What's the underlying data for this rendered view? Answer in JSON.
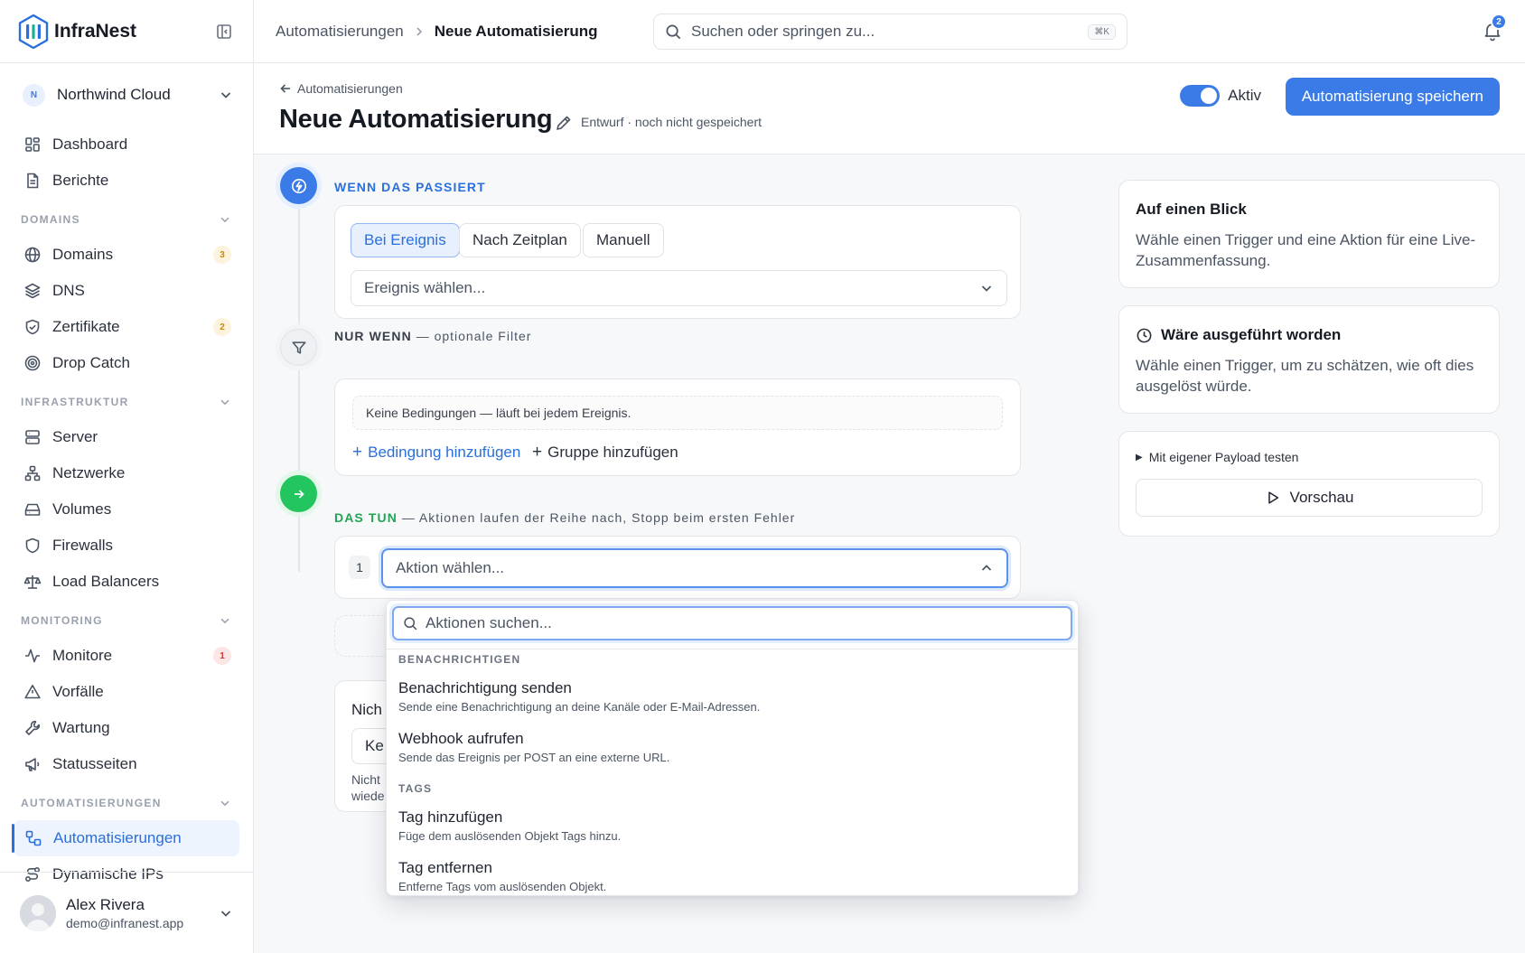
{
  "app": {
    "name": "InfraNest"
  },
  "org": {
    "initial": "N",
    "name": "Northwind Cloud"
  },
  "nav": {
    "top": [
      {
        "label": "Dashboard",
        "icon": "dashboard-icon"
      },
      {
        "label": "Berichte",
        "icon": "report-icon"
      }
    ],
    "sections": [
      {
        "title": "DOMAINS",
        "items": [
          {
            "label": "Domains",
            "icon": "globe-icon",
            "badge": "3",
            "badge_color": "amber"
          },
          {
            "label": "DNS",
            "icon": "layers-icon"
          },
          {
            "label": "Zertifikate",
            "icon": "shield-check-icon",
            "badge": "2",
            "badge_color": "amber"
          },
          {
            "label": "Drop Catch",
            "icon": "target-icon"
          }
        ]
      },
      {
        "title": "INFRASTRUKTUR",
        "items": [
          {
            "label": "Server",
            "icon": "server-icon"
          },
          {
            "label": "Netzwerke",
            "icon": "network-icon"
          },
          {
            "label": "Volumes",
            "icon": "drive-icon"
          },
          {
            "label": "Firewalls",
            "icon": "shield-icon"
          },
          {
            "label": "Load Balancers",
            "icon": "scale-icon"
          }
        ]
      },
      {
        "title": "MONITORING",
        "items": [
          {
            "label": "Monitore",
            "icon": "activity-icon",
            "badge": "1",
            "badge_color": "red"
          },
          {
            "label": "Vorfälle",
            "icon": "warning-icon"
          },
          {
            "label": "Wartung",
            "icon": "wrench-icon"
          },
          {
            "label": "Statusseiten",
            "icon": "megaphone-icon"
          }
        ]
      },
      {
        "title": "AUTOMATISIERUNGEN",
        "items": [
          {
            "label": "Automatisierungen",
            "icon": "workflow-icon",
            "active": true
          },
          {
            "label": "Dynamische IPs",
            "icon": "route-icon"
          }
        ]
      }
    ]
  },
  "user": {
    "name": "Alex Rivera",
    "email": "demo@infranest.app"
  },
  "topbar": {
    "breadcrumb_parent": "Automatisierungen",
    "breadcrumb_current": "Neue Automatisierung",
    "search_placeholder": "Suchen oder springen zu...",
    "search_shortcut": "⌘K",
    "notification_count": "2"
  },
  "page": {
    "back_label": "Automatisierungen",
    "title": "Neue Automatisierung",
    "draft_note": "Entwurf · noch nicht gespeichert",
    "active_label": "Aktiv",
    "save_label": "Automatisierung speichern"
  },
  "trigger": {
    "heading": "WENN DAS PASSIERT",
    "modes": [
      "Bei Ereignis",
      "Nach Zeitplan",
      "Manuell"
    ],
    "selected_mode": "Bei Ereignis",
    "event_placeholder": "Ereignis wählen..."
  },
  "filter": {
    "heading": "NUR WENN",
    "subheading": "— optionale Filter",
    "empty_text": "Keine Bedingungen — läuft bei jedem Ereignis.",
    "add_condition": "Bedingung hinzufügen",
    "add_group": "Gruppe hinzufügen"
  },
  "actions": {
    "heading": "DAS TUN",
    "subheading": "— Aktionen laufen der Reihe nach, Stopp beim ersten Fehler",
    "step_number": "1",
    "action_placeholder": "Aktion wählen..."
  },
  "error_card": {
    "title_partial": "Nich",
    "select_partial": "Ke",
    "note_partial_1": "Nicht",
    "note_partial_2": "wiede"
  },
  "dropdown": {
    "search_placeholder": "Aktionen suchen...",
    "groups": [
      {
        "title": "BENACHRICHTIGEN",
        "items": [
          {
            "title": "Benachrichtigung senden",
            "desc": "Sende eine Benachrichtigung an deine Kanäle oder E-Mail-Adressen."
          },
          {
            "title": "Webhook aufrufen",
            "desc": "Sende das Ereignis per POST an eine externe URL."
          }
        ]
      },
      {
        "title": "TAGS",
        "items": [
          {
            "title": "Tag hinzufügen",
            "desc": "Füge dem auslösenden Objekt Tags hinzu."
          },
          {
            "title": "Tag entfernen",
            "desc": "Entferne Tags vom auslösenden Objekt."
          }
        ]
      }
    ]
  },
  "side": {
    "glance_title": "Auf einen Blick",
    "glance_text": "Wähle einen Trigger und eine Aktion für eine Live-Zusammenfassung.",
    "would_run_title": "Wäre ausgeführt worden",
    "would_run_text": "Wähle einen Trigger, um zu schätzen, wie oft dies ausgelöst würde.",
    "payload_label": "Mit eigener Payload testen",
    "preview_label": "Vorschau"
  },
  "colors": {
    "accent": "#3b7be8",
    "success": "#22c55e",
    "warning_badge": "#c68a12",
    "danger_badge": "#d23c3c"
  }
}
